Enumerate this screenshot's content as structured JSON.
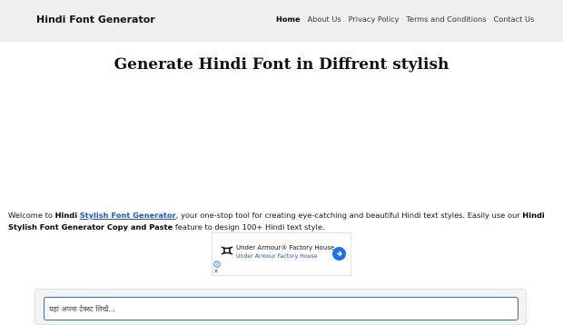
{
  "header": {
    "brand": "Hindi Font Generator",
    "nav": [
      {
        "label": "Home",
        "active": true
      },
      {
        "label": "About Us",
        "active": false
      },
      {
        "label": "Privacy Policy",
        "active": false
      },
      {
        "label": "Terms and Conditions",
        "active": false
      },
      {
        "label": "Contact Us",
        "active": false
      }
    ]
  },
  "main": {
    "title": "Generate Hindi Font in Diffrent stylish",
    "intro": {
      "part1": "Welcome to ",
      "bold1": "Hindi",
      "link": "Stylish Font Generator",
      "part2": ", your one-stop tool for creating eye-catching and beautiful Hindi text styles. Easily use our ",
      "bold2": "Hindi Stylish Font Generator Copy and Paste",
      "part3": " feature to design 100+ Hindi text style."
    },
    "input": {
      "placeholder": "यहां अपना टेक्स्ट लिखें..."
    }
  },
  "ad": {
    "title": "Under Armour® Factory House",
    "subtitle": "Under Armour Factory House",
    "icons": [
      "under-armour-logo",
      "arrow-right-icon",
      "ad-info-icon",
      "ad-close-icon"
    ]
  },
  "colors": {
    "nav_bg": "#efefef",
    "link": "#1a57c9",
    "input_border": "#2a6fdb"
  }
}
